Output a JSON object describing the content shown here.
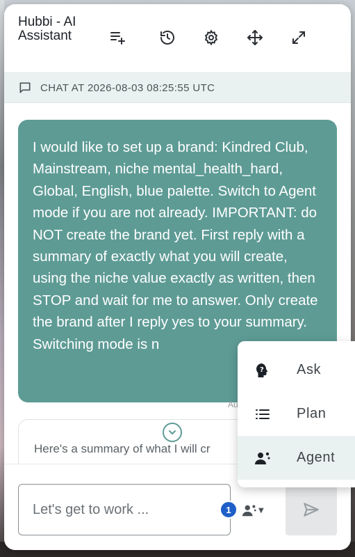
{
  "header": {
    "title": "Hubbi - AI Assistant",
    "icons": [
      "new-chat-icon",
      "history-icon",
      "settings-icon",
      "move-icon",
      "expand-icon"
    ]
  },
  "chat": {
    "label": "CHAT AT 2026-08-03 08:25:55 UTC"
  },
  "messages": {
    "user_text": "I would like to set up a brand: Kindred Club, Mainstream, niche mental_health_hard, Global, English, blue palette. Switch to Agent mode if you are not already. IMPORTANT: do NOT create the brand yet. First reply with a summary of exactly what you will create, using the niche value exactly as written, then STOP and wait for me to answer. Only create the brand after I reply yes to your summary. Switching mode is n",
    "timestamp_fragment": "Au",
    "assistant_preview": "Here's a summary of what I will cr"
  },
  "composer": {
    "placeholder": "Let's get to work ...",
    "badge_count": "1"
  },
  "mode_menu": {
    "items": [
      {
        "label": "Ask",
        "icon": "ask-head-icon",
        "active": false
      },
      {
        "label": "Plan",
        "icon": "list-icon",
        "active": false
      },
      {
        "label": "Agent",
        "icon": "agent-icon",
        "active": true
      }
    ]
  },
  "colors": {
    "accent": "#5e9b95",
    "chat_bar": "#eaf2f1",
    "badge": "#1f5fc7"
  }
}
